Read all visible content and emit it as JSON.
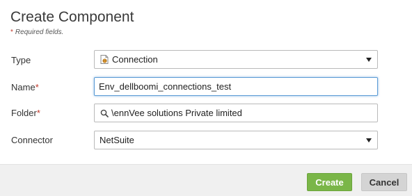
{
  "dialog": {
    "title": "Create Component",
    "required_star": "*",
    "required_note": "Required fields."
  },
  "form": {
    "type_label": "Type",
    "type_value": "Connection",
    "name_label": "Name",
    "name_required": "*",
    "name_value": "Env_dellboomi_connections_test",
    "folder_label": "Folder",
    "folder_required": "*",
    "folder_value": "\\ennVee solutions Private limited",
    "connector_label": "Connector",
    "connector_value": "NetSuite"
  },
  "buttons": {
    "create": "Create",
    "cancel": "Cancel"
  },
  "colors": {
    "create_button": "#7ab648",
    "cancel_button": "#d4d4d4",
    "required_star": "#c0392b",
    "focus_border": "#5b9bd5"
  },
  "icons": {
    "type_icon": "connection-icon",
    "folder_icon": "search-icon",
    "dropdown_icon": "chevron-down-icon"
  }
}
